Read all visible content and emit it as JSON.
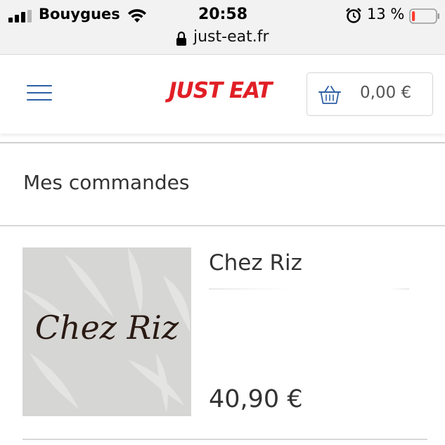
{
  "status_bar": {
    "carrier": "Bouygues",
    "time": "20:58",
    "battery_percent": "13 %",
    "battery_level": 0.13,
    "url": "just-eat.fr"
  },
  "header": {
    "logo": "JUST EAT",
    "cart_total": "0,00 €"
  },
  "page": {
    "title": "Mes commandes"
  },
  "orders": [
    {
      "restaurant": "Chez Riz",
      "logo_text": "Chez Riz",
      "price": "40,90 €"
    }
  ],
  "colors": {
    "brand_red": "#e11f26",
    "accent_blue": "#2d5fa4",
    "battery_low": "#ff3b30"
  }
}
